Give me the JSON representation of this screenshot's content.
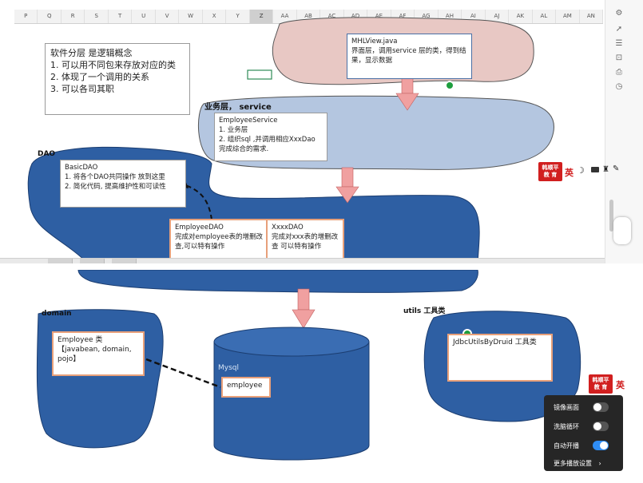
{
  "spreadsheet": {
    "columns": [
      "P",
      "Q",
      "R",
      "S",
      "T",
      "U",
      "V",
      "W",
      "X",
      "Y",
      "Z",
      "AA",
      "AB",
      "AC",
      "AD",
      "AE",
      "AF",
      "AG",
      "AH",
      "AI",
      "AJ",
      "AK",
      "AL",
      "AM",
      "AN"
    ],
    "selected_column": "Z"
  },
  "concept_box": {
    "title": "软件分层 是逻辑概念",
    "items": [
      "1. 可以用不同包来存放对应的类",
      "2. 体现了一个调用的关系",
      "3. 可以各司其职"
    ]
  },
  "view_layer": {
    "title": "MHLView.java",
    "desc": "界面层，调用service 层的类，得到结果，显示数据"
  },
  "service_layer": {
    "label": "业务层， service",
    "title": "EmployeeService",
    "items": [
      "1. 业务层",
      "2. 组织sql ,并调用相应XxxDao 完成综合的需求."
    ]
  },
  "dao_layer": {
    "label": "DAO",
    "base_title": "BasicDAO",
    "base_items": [
      "1. 将各个DAO共同操作 放到这里",
      "2. 简化代码, 提高维护性和可读性"
    ],
    "employee_dao_title": "EmployeeDAO",
    "employee_dao_desc": "完成对employee表的增删改查,可以特有操作",
    "xxx_dao_title": "XxxxDAO",
    "xxx_dao_desc": "完成对xxx表的增删改查 可以特有操作"
  },
  "domain_layer": {
    "label": "domain",
    "box_title": "Employee 类",
    "box_desc": "【javabean, domain, pojo】"
  },
  "database": {
    "label": "Mysql",
    "table": "employee"
  },
  "utils_layer": {
    "label": "utils 工具类",
    "box_text": "JdbcUtilsByDruid 工具类"
  },
  "logo": {
    "line1": "韩顺平",
    "line2": "教 育",
    "lang": "英"
  },
  "player_settings": {
    "mirror_label": "镜像画面",
    "mirror_on": false,
    "loop_label": "洗脑循环",
    "loop_on": false,
    "autoplay_label": "自动开播",
    "autoplay_on": true,
    "more_label": "更多播放设置",
    "more_icon": "chevron-right-icon"
  },
  "colors": {
    "dark_blue": "#2e5fa3",
    "light_blue": "#b4c6e0",
    "pink": "#e8c8c4",
    "arrow": "#f0a0a0",
    "orange_border": "#e8a07a",
    "toggle_on": "#2f8df5"
  }
}
